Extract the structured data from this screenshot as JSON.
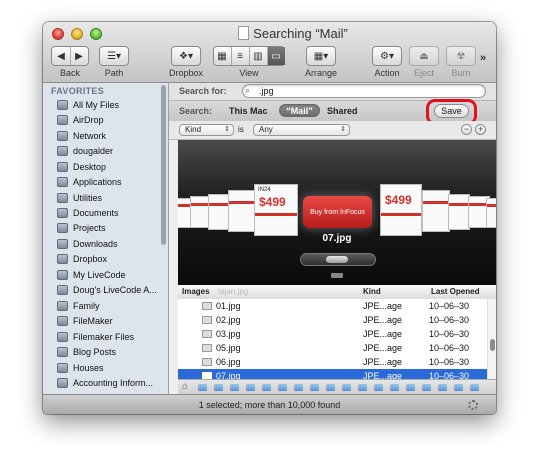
{
  "window": {
    "title": "Searching “Mail”"
  },
  "toolbar": {
    "back_label": "Back",
    "path_label": "Path",
    "dropbox_label": "Dropbox",
    "view_label": "View",
    "arrange_label": "Arrange",
    "action_label": "Action",
    "eject_label": "Eject",
    "burn_label": "Burn",
    "overflow_glyph": "»"
  },
  "sidebar": {
    "header": "FAVORITES",
    "items": [
      {
        "label": "All My Files"
      },
      {
        "label": "AirDrop"
      },
      {
        "label": "Network"
      },
      {
        "label": "dougalder"
      },
      {
        "label": "Desktop"
      },
      {
        "label": "Applications"
      },
      {
        "label": "Utilities"
      },
      {
        "label": "Documents"
      },
      {
        "label": "Projects"
      },
      {
        "label": "Downloads"
      },
      {
        "label": "Dropbox"
      },
      {
        "label": "My LiveCode"
      },
      {
        "label": "Doug's LiveCode A..."
      },
      {
        "label": "Family"
      },
      {
        "label": "FileMaker"
      },
      {
        "label": "Filemaker Files"
      },
      {
        "label": "Blog Posts"
      },
      {
        "label": "Houses"
      },
      {
        "label": "Accounting Inform..."
      }
    ]
  },
  "search": {
    "label": "Search for:",
    "value": ".jpg",
    "scope_label": "Search:",
    "scope_this_mac": "This Mac",
    "scope_mail": "“Mail”",
    "scope_shared": "Shared",
    "save_label": "Save"
  },
  "criteria": {
    "attribute": "Kind",
    "operator": "is",
    "value": "Any",
    "remove_glyph": "−",
    "add_glyph": "+"
  },
  "coverflow": {
    "selected_name": "07.jpg",
    "left_card_price": "$499",
    "left_card_tag": "IN24",
    "center_card_text": "Buy from InFocus",
    "right_card_price": "$499"
  },
  "list": {
    "columns": {
      "name": "Images",
      "name_ghost": "tajan.jpg",
      "kind": "Kind",
      "date": "Last Opened"
    },
    "rows": [
      {
        "name": "01.jpg",
        "kind": "JPE...age",
        "date": "10–06–30"
      },
      {
        "name": "02.jpg",
        "kind": "JPE...age",
        "date": "10–06–30"
      },
      {
        "name": "03.jpg",
        "kind": "JPE...age",
        "date": "10–06–30"
      },
      {
        "name": "05.jpg",
        "kind": "JPE...age",
        "date": "10–06–30"
      },
      {
        "name": "06.jpg",
        "kind": "JPE...age",
        "date": "10–06–30"
      },
      {
        "name": "07.jpg",
        "kind": "JPE...age",
        "date": "10–06–30"
      }
    ],
    "selected_index": 5
  },
  "status": {
    "text": "1 selected; more than 10,000 found"
  },
  "colors": {
    "selection": "#2a6ad8",
    "highlight_ring": "#e60f19",
    "sidebar_bg": "#dde4ec"
  }
}
